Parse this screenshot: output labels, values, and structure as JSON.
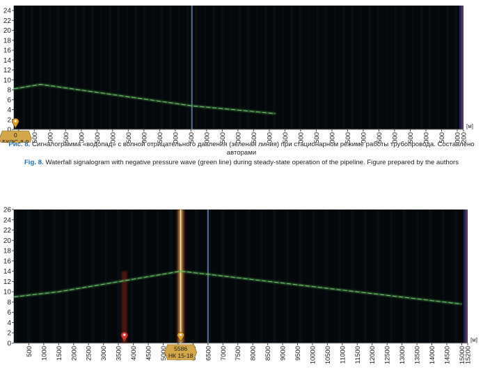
{
  "captions": {
    "ru_label": "Рис. 8.",
    "ru_text": "Сигналограмма «водопад» с волной отрицательного давления (зеленая линия) при стационарном режиме работы трубопровода. Составлено авторами",
    "en_label": "Fig. 8.",
    "en_text": "Waterfall signalogram with negative pressure wave (green line) during steady-state operation of the pipeline. Figure prepared by the authors"
  },
  "colors": {
    "background": "#05080b",
    "wave": "#4fae4b",
    "leak": "#f0c040",
    "marker_orange": "#e0a020",
    "marker_red": "#d83030",
    "label_bg": "#d4a84a"
  },
  "chart_data": [
    {
      "type": "heatmap",
      "title": "",
      "xlabel": "[м]",
      "ylabel": "",
      "xlim": [
        850,
        15200
      ],
      "ylim": [
        0,
        25
      ],
      "y_ticks": [
        0,
        2,
        4,
        6,
        8,
        10,
        12,
        14,
        16,
        18,
        20,
        22,
        24
      ],
      "x_ticks": [
        1000,
        1500,
        2000,
        2500,
        3000,
        3500,
        4000,
        4500,
        5000,
        5500,
        6000,
        6500,
        7000,
        7500,
        8000,
        8500,
        9000,
        9500,
        10000,
        10500,
        11000,
        11500,
        12000,
        12500,
        13000,
        13500,
        14000,
        14500,
        15000,
        15200
      ],
      "x_tick_labels": [
        "1000",
        "1500",
        "2000",
        "2500",
        "3000",
        "3500",
        "4000",
        "4500",
        "5000",
        "5500",
        "6000",
        "6500",
        "7000",
        "7500",
        "8000",
        "8500",
        "9000",
        "9500",
        "10000",
        "10500",
        "11000",
        "11500",
        "12000",
        "12500",
        "13000",
        "13500",
        "14000",
        "14500",
        "15000",
        "15200"
      ],
      "series": [
        {
          "name": "",
          "x": [
            850,
            1700,
            6500,
            9200
          ],
          "y": [
            8.2,
            9.1,
            4.8,
            3.2
          ]
        }
      ],
      "markers": [
        {
          "x": 900,
          "label_lines": [
            "0",
            "БКЭС-8-0"
          ],
          "color": "orange"
        }
      ],
      "bright_column_x": 6530
    },
    {
      "type": "heatmap",
      "title": "",
      "xlabel": "[м]",
      "ylabel": "",
      "xlim": [
        0,
        15200
      ],
      "ylim": [
        0,
        26
      ],
      "y_ticks": [
        0,
        2,
        4,
        6,
        8,
        10,
        12,
        14,
        16,
        18,
        20,
        22,
        24,
        26
      ],
      "x_ticks": [
        500,
        1000,
        1500,
        2000,
        2500,
        3000,
        3500,
        4000,
        4500,
        5000,
        5500,
        6000,
        6500,
        7000,
        7500,
        8000,
        8500,
        9000,
        9500,
        10000,
        10500,
        11000,
        11500,
        12000,
        12500,
        13000,
        13500,
        14000,
        14500,
        15000,
        15200
      ],
      "x_tick_labels": [
        "500",
        "1000",
        "1500",
        "2000",
        "2500",
        "3000",
        "3500",
        "4000",
        "4500",
        "5000",
        "5500",
        "6000",
        "6500",
        "7000",
        "7500",
        "8000",
        "8500",
        "9000",
        "9500",
        "10000",
        "10500",
        "11000",
        "11500",
        "12000",
        "12500",
        "13000",
        "13500",
        "14000",
        "14500",
        "15000",
        "15200"
      ],
      "series": [
        {
          "name": "",
          "x": [
            0,
            1500,
            5586,
            6500,
            15000
          ],
          "y": [
            9,
            10,
            14,
            13.4,
            7.6
          ]
        }
      ],
      "leak_column": {
        "x": 5586,
        "y_range": [
          0,
          26
        ]
      },
      "secondary_column": {
        "x": 3700,
        "y_range": [
          0,
          14
        ]
      },
      "markers": [
        {
          "x": 3700,
          "label_lines": [],
          "color": "red"
        },
        {
          "x": 5586,
          "label_lines": [
            "5586",
            "НК 15-18"
          ],
          "color": "orange"
        }
      ],
      "bright_column_x": 6500
    }
  ]
}
